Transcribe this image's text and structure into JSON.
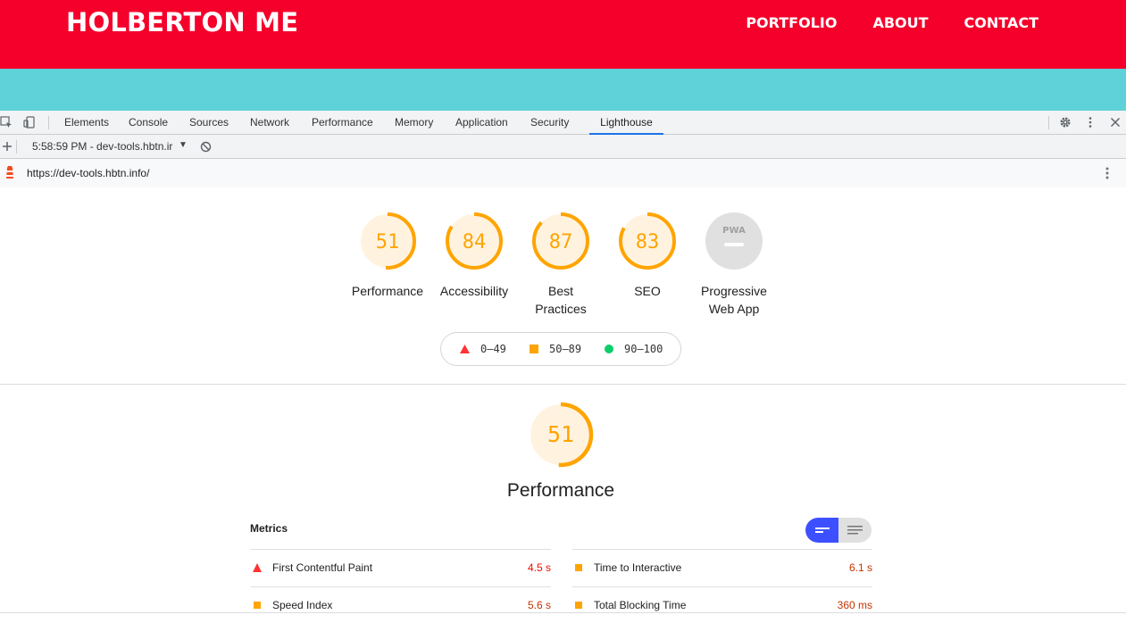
{
  "site": {
    "logo": "HOLBERTON ME",
    "nav": [
      "PORTFOLIO",
      "ABOUT",
      "CONTACT"
    ],
    "colors": {
      "header": "#f5002b",
      "band": "#5fd1d9"
    }
  },
  "devtools": {
    "tabs": [
      "Elements",
      "Console",
      "Sources",
      "Network",
      "Performance",
      "Memory",
      "Application",
      "Security",
      "Lighthouse"
    ],
    "active_tab": "Lighthouse",
    "report_label": "5:58:59 PM - dev-tools.hbtn.ir",
    "url": "https://dev-tools.hbtn.info/"
  },
  "categories": [
    {
      "score": "51",
      "label": "Performance",
      "fraction": 0.51
    },
    {
      "score": "84",
      "label": "Accessibility",
      "fraction": 0.84
    },
    {
      "score": "87",
      "label": "Best Practices",
      "label_lines": [
        "Best",
        "Practices"
      ],
      "fraction": 0.87
    },
    {
      "score": "83",
      "label": "SEO",
      "fraction": 0.83
    },
    {
      "label": "Progressive Web App",
      "label_lines": [
        "Progressive",
        "Web App"
      ],
      "badge": "PWA"
    }
  ],
  "legend": [
    {
      "range": "0–49",
      "color": "#ff3333",
      "shape": "triangle"
    },
    {
      "range": "50–89",
      "color": "#ffa400",
      "shape": "square"
    },
    {
      "range": "90–100",
      "color": "#0cce6b",
      "shape": "circle"
    }
  ],
  "performance": {
    "score": "51",
    "fraction": 0.51,
    "title": "Performance",
    "metrics_title": "Metrics",
    "metrics_left": [
      {
        "name": "First Contentful Paint",
        "value": "4.5 s",
        "status": "fail"
      },
      {
        "name": "Speed Index",
        "value": "5.6 s",
        "status": "average"
      }
    ],
    "metrics_right": [
      {
        "name": "Time to Interactive",
        "value": "6.1 s",
        "status": "average"
      },
      {
        "name": "Total Blocking Time",
        "value": "360 ms",
        "status": "average"
      }
    ]
  },
  "colors": {
    "average": "#ffa400",
    "average_bg": "#fff3e0",
    "fail": "#ff3333",
    "accent": "#1a73e8",
    "toggle_on": "#3d50ff"
  }
}
